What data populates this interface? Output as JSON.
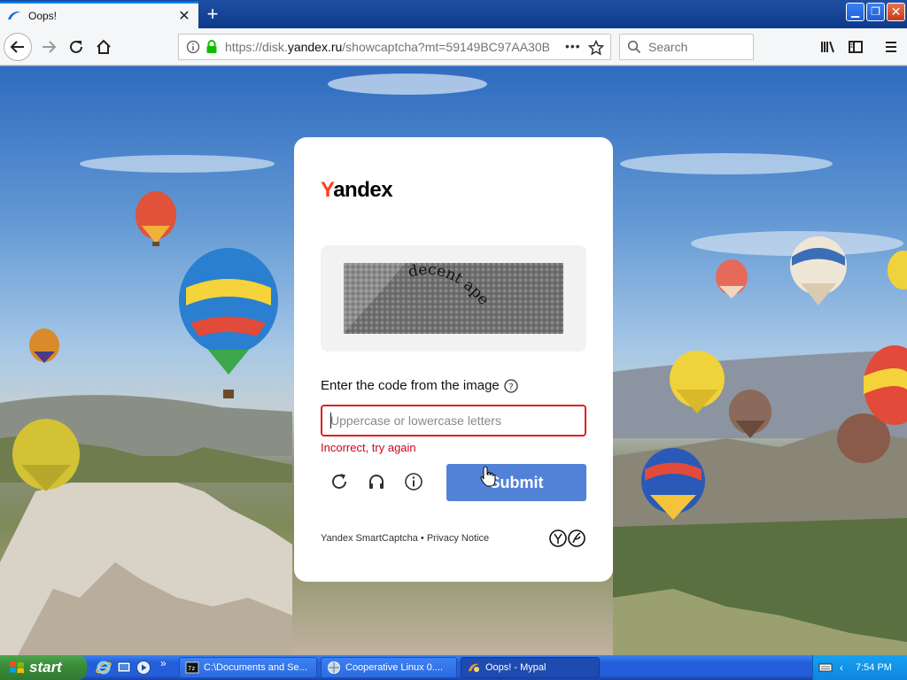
{
  "browser": {
    "tab_title": "Oops!",
    "tab_close": "✕",
    "new_tab": "+",
    "url_scheme": "https://disk.",
    "url_domain": "yandex.ru",
    "url_path": "/showcaptcha?mt=59149BC97AA30B",
    "page_actions": "•••",
    "search_placeholder": "Search",
    "window_controls": {
      "minimize": "▁",
      "restore": "❐",
      "close": "✕"
    }
  },
  "captcha": {
    "logo_first": "Y",
    "logo_rest": "andex",
    "image_text": "decent ape",
    "prompt": "Enter the code from the image",
    "input_value": "",
    "input_placeholder": "Uppercase or lowercase letters",
    "error": "Incorrect, try again",
    "submit_label": "Submit",
    "footer": "Yandex SmartCaptcha • Privacy Notice"
  },
  "taskbar": {
    "start_label": "start",
    "quicklaunch_more": "»",
    "tasks": [
      {
        "label": "C:\\Documents and Se...",
        "icon": "cmd-icon"
      },
      {
        "label": "Cooperative Linux 0....",
        "icon": "globe-icon"
      },
      {
        "label": "Oops! - Mypal",
        "icon": "mypal-icon"
      }
    ],
    "tray_chevron": "‹",
    "clock": "7:54 PM"
  },
  "colors": {
    "accent": "#0a84ff",
    "yandex_red": "#fc3f1d",
    "submit_blue": "#5282d8",
    "error_red": "#d0021b",
    "xp_blue": "#245edb",
    "start_green": "#3a8d3a"
  }
}
